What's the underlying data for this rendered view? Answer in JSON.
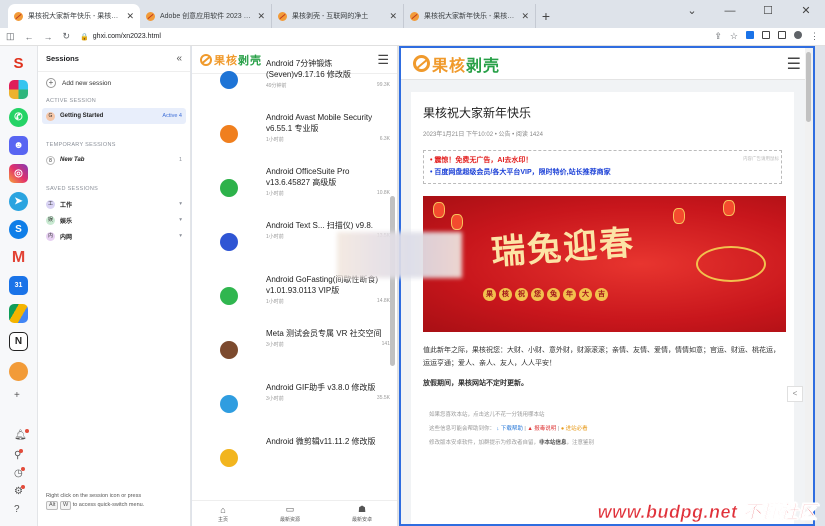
{
  "browser": {
    "tabs": [
      {
        "title": "果核祝大家新年快乐 - 果核剥壳",
        "active": true
      },
      {
        "title": "Adobe 创意应用软件 2023 合集 ...",
        "active": false
      },
      {
        "title": "果核剥壳 - 互联网的净土",
        "active": false
      },
      {
        "title": "果核祝大家新年快乐 - 果核剥壳",
        "active": false
      }
    ],
    "url": "ghxi.com/xn2023.html",
    "accent": "#2f6de0"
  },
  "sessions": {
    "title": "Sessions",
    "add_label": "Add new session",
    "active_header": "ACTIVE SESSION",
    "active": [
      {
        "badge": "G",
        "label": "Getting Started",
        "meta": "Active 4"
      }
    ],
    "temp_header": "TEMPORARY SESSIONS",
    "temp": [
      {
        "badge": "8",
        "label": "New Tab",
        "meta": "1"
      }
    ],
    "saved_header": "SAVED SESSIONS",
    "saved": [
      {
        "badge": "工",
        "label": "工作"
      },
      {
        "badge": "娱",
        "label": "娱乐"
      },
      {
        "badge": "内",
        "label": "内网"
      }
    ],
    "footer_text": "Right click on the session icon or press",
    "footer_key1": "Alt",
    "footer_key2": "W",
    "footer_text2": "to access quick-switch menu."
  },
  "mid": {
    "logo_a": "果核",
    "logo_b": "剥壳",
    "items": [
      {
        "title": "Android 7分钟锻炼(Seven)v9.17.16 修改版",
        "time": "49分钟前",
        "views": "99.3K",
        "color": "#1e74d6"
      },
      {
        "title": "Android Avast Mobile Security v6.55.1 专业版",
        "time": "1小时前",
        "views": "6.3K",
        "color": "#f07f1e"
      },
      {
        "title": "Android OfficeSuite Pro v13.6.45827 高级版",
        "time": "1小时前",
        "views": "10.8K",
        "color": "#2db24a"
      },
      {
        "title": "Android Text S... 扫描仪) v9.8.",
        "time": "1小时前",
        "views": "13.5K",
        "color": "#2f55d4"
      },
      {
        "title": "Android GoFasting(间歇性断食) v1.01.93.0113 VIP版",
        "time": "1小时前",
        "views": "14.8K",
        "color": "#30b64f"
      },
      {
        "title": "Meta 测试会员专属 VR 社交空间",
        "time": "3小时前",
        "views": "141",
        "color": "#7c4a2e"
      },
      {
        "title": "Android GIF助手 v3.8.0 修改版",
        "time": "3小时前",
        "views": "35.5K",
        "color": "#2f9de0"
      },
      {
        "title": "Android 微剪辑v11.11.2 修改版",
        "time": "",
        "views": "",
        "color": "#f2b51e"
      }
    ],
    "nav": [
      "主页",
      "最新资源",
      "最新安卓"
    ]
  },
  "article": {
    "logo_a": "果核",
    "logo_b": "剥壳",
    "title": "果核祝大家新年快乐",
    "meta": "2023年1月21日 下午10:02 • 公告 • 阅读 1424",
    "notice1": "• 震惊！免费无广告，AI去水印！",
    "notice2": "• 百度网盘超级会员/各大平台VIP，限时特价,站长推荐商家",
    "notice_tag": "内容广告请用鼠标",
    "banner_text": "瑞兔迎春",
    "banner_sub": [
      "果",
      "核",
      "祝",
      "您",
      "兔",
      "年",
      "大",
      "吉"
    ],
    "body": "值此新年之际，果核祝您：大财、小财、意外财，财源滚滚；亲情、友情、爱情，情情如意；官运、财运、桃花运，运运亨通；爱人、亲人、友人，人人平安！",
    "holiday": "放假期间，果核网站不定时更新。",
    "foot1": "如果您喜欢本站，点击这儿不花一分钱用哪本站",
    "foot2_a": "这些信息可能会帮助到你：",
    "foot2_b": "↓ 下载帮助",
    "foot2_c": "▲ 报毒说明",
    "foot2_d": "● 进站必看",
    "foot3_a": "修改版本安卓软件，加群提示为修改者自留，",
    "foot3_b": "非本站信息",
    "foot3_c": "，注意鉴别"
  },
  "watermark": "www.budpg.net 不懂社区"
}
